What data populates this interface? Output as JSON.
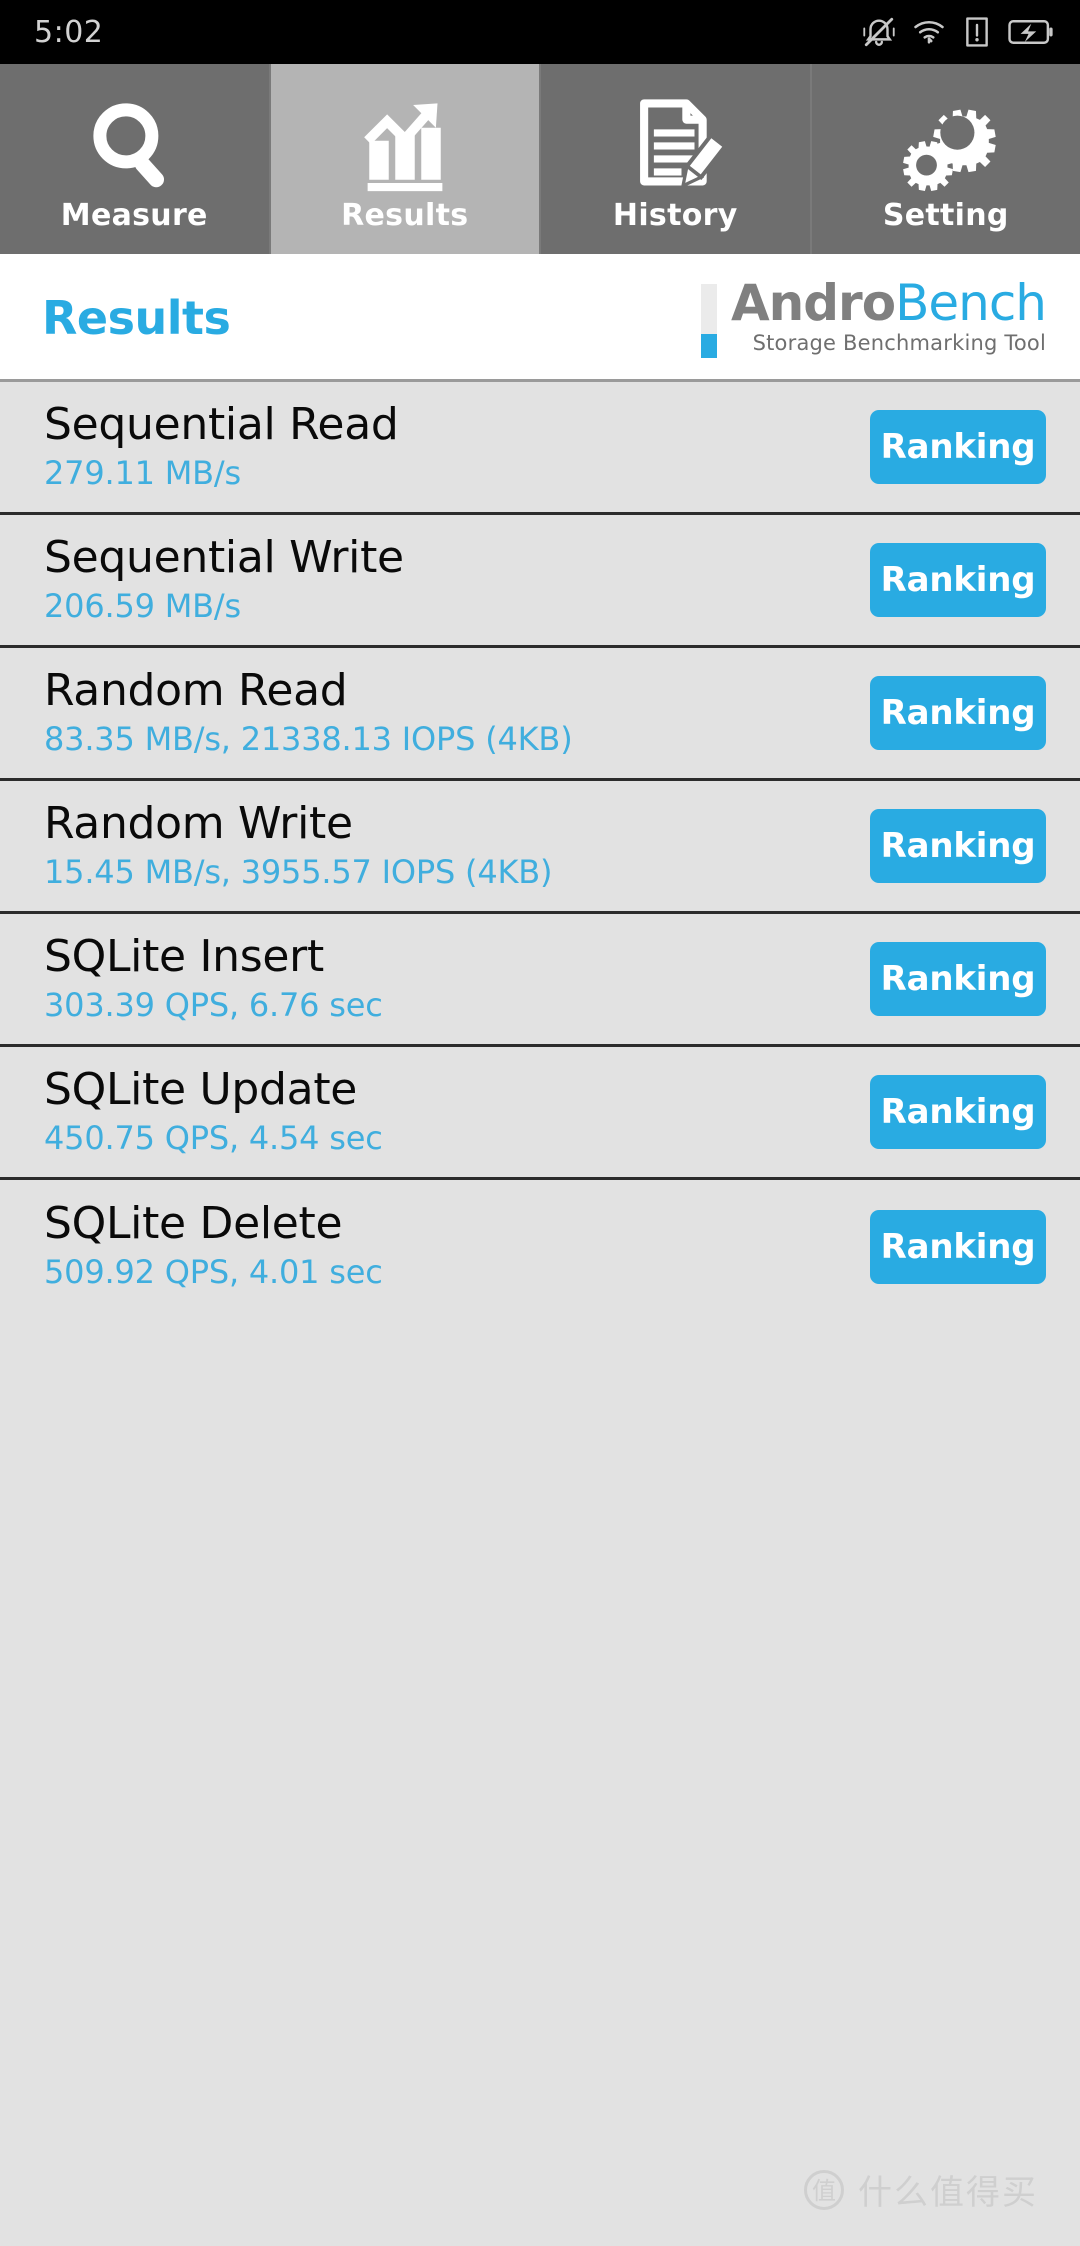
{
  "statusbar": {
    "time": "5:02",
    "icons": [
      {
        "name": "vibrate-off-icon"
      },
      {
        "name": "wifi-icon"
      },
      {
        "name": "sim-alert-icon"
      },
      {
        "name": "battery-charging-icon"
      }
    ]
  },
  "tabs": [
    {
      "label": "Measure",
      "icon": "magnifier-icon",
      "active": false
    },
    {
      "label": "Results",
      "icon": "bar-chart-growth-icon",
      "active": true
    },
    {
      "label": "History",
      "icon": "document-pencil-icon",
      "active": false
    },
    {
      "label": "Setting",
      "icon": "gears-icon",
      "active": false
    }
  ],
  "header": {
    "page_title": "Results",
    "logo_primary": "Andro",
    "logo_secondary": "Bench",
    "logo_subtitle": "Storage Benchmarking Tool"
  },
  "results": {
    "ranking_label": "Ranking",
    "rows": [
      {
        "title": "Sequential Read",
        "value": "279.11 MB/s"
      },
      {
        "title": "Sequential Write",
        "value": "206.59 MB/s"
      },
      {
        "title": "Random Read",
        "value": "83.35 MB/s, 21338.13 IOPS (4KB)"
      },
      {
        "title": "Random Write",
        "value": "15.45 MB/s, 3955.57 IOPS (4KB)"
      },
      {
        "title": "SQLite Insert",
        "value": "303.39 QPS, 6.76 sec"
      },
      {
        "title": "SQLite Update",
        "value": "450.75 QPS, 4.54 sec"
      },
      {
        "title": "SQLite Delete",
        "value": "509.92 QPS, 4.01 sec"
      }
    ]
  },
  "watermark": {
    "badge": "值",
    "text": "什么值得买"
  },
  "colors": {
    "accent_blue": "#29abe2",
    "value_blue": "#40aede",
    "tab_inactive": "#6e6e6e",
    "tab_active": "#b4b4b4",
    "row_bg": "#e2e2e2",
    "logo_gray": "#808080"
  }
}
